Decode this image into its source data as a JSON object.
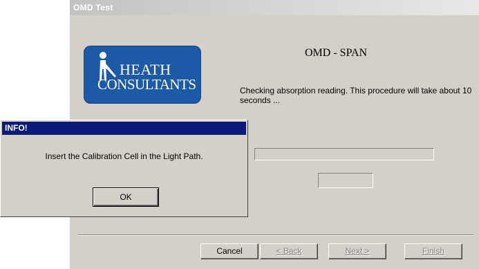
{
  "window": {
    "title": "OMD Test",
    "logo": {
      "line1": "HEATH",
      "line2": "CONSULTANTS"
    },
    "heading": "OMD - SPAN",
    "message": "Checking absorption reading. This procedure will take about 10 seconds ...",
    "progress": 0,
    "readout": "",
    "buttons": {
      "cancel": "Cancel",
      "back": "< Back",
      "next": "Next >",
      "finish": "Finish"
    }
  },
  "dialog": {
    "title": "INFO!",
    "message": "Insert the Calibration Cell in the Light Path.",
    "ok": "OK"
  },
  "colors": {
    "dialog_title_bg": "#0c1b7a",
    "logo_bg": "#1d5aa6",
    "face": "#d4d0c8"
  }
}
